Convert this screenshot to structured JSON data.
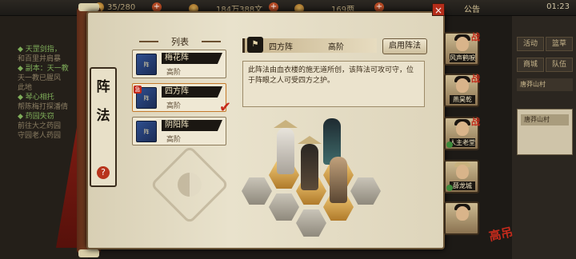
{
  "topbar": {
    "stamina": "35/280",
    "copper": "184万388文",
    "silver": "169两",
    "notice": "公告",
    "clock": "01:23"
  },
  "quests": [
    {
      "text": "◆ 天罡剑指，",
      "hl": true
    },
    {
      "text": "和百里并肩暴",
      "hl": false
    },
    {
      "text": "◆ 副本：天一教",
      "hl": true
    },
    {
      "text": "天一教已腥风",
      "hl": false
    },
    {
      "text": "此地",
      "hl": false
    },
    {
      "text": "◆ 琴心相托",
      "hl": true
    },
    {
      "text": "帮陈梅打探潘倩",
      "hl": false
    },
    {
      "text": "◆ 药园失窃",
      "hl": true
    },
    {
      "text": "前往大之药园",
      "hl": false
    },
    {
      "text": "守园老人药园",
      "hl": false
    }
  ],
  "sidebar": {
    "buttons": [
      "活动",
      "篮草",
      "商城",
      "队伍"
    ],
    "location_label": "唐莽山村",
    "location_item": "唐莽山村"
  },
  "seal": "高吊",
  "panel": {
    "ribbon_title_1": "阵",
    "ribbon_title_2": "法",
    "help_icon": "?",
    "close_label": "×",
    "list_title": "列表",
    "items": [
      {
        "name": "梅花阵",
        "grade": "高阶",
        "badge": ""
      },
      {
        "name": "四方阵",
        "grade": "高阶",
        "badge": "急"
      },
      {
        "name": "阴阳阵",
        "grade": "高阶",
        "badge": ""
      }
    ],
    "selected_check": "✔"
  },
  "detail": {
    "name": "四方阵",
    "grade": "高阶",
    "enable_button": "启用阵法",
    "description": "此阵法由血衣楼的施无道所创，该阵法可攻可守，位于阵眼之人可受四方之护。"
  },
  "portraits": [
    {
      "name": "风声鹤唳",
      "badge": "战"
    },
    {
      "name": "燕昊乾",
      "badge": "战"
    },
    {
      "name": "人主老堂",
      "badge": "战"
    },
    {
      "name": "薛龙城",
      "badge": ""
    },
    {
      "name": "",
      "badge": ""
    }
  ]
}
